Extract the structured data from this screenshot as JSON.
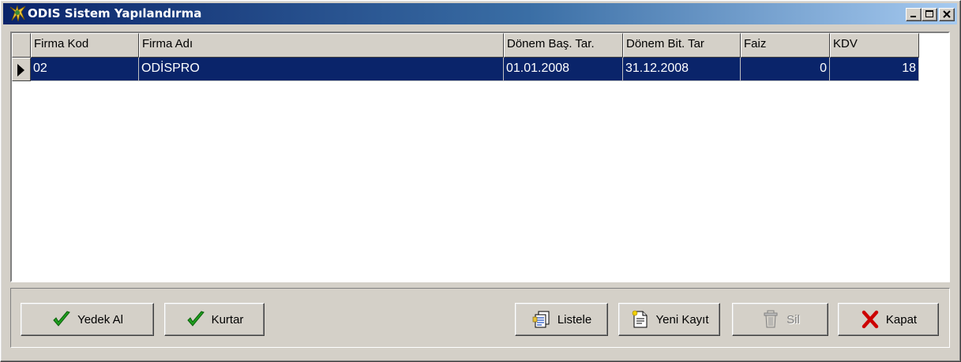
{
  "window": {
    "title": "ODIS Sistem Yapılandırma",
    "icon": "odis-app-icon",
    "controls": [
      "minimize-icon",
      "maximize-icon",
      "close-icon"
    ]
  },
  "grid": {
    "columns": [
      "Firma Kod",
      "Firma Adı",
      "Dönem Baş. Tar.",
      "Dönem Bit. Tar",
      "Faiz",
      "KDV"
    ],
    "rows": [
      {
        "firma_kod": "02",
        "firma_adi": "ODİSPRO",
        "donem_bas": "01.01.2008",
        "donem_bit": "31.12.2008",
        "faiz": "0",
        "kdv": "18"
      }
    ],
    "selection_color": "#0a246a"
  },
  "buttons": {
    "yedek_al": {
      "label": "Yedek Al",
      "icon": "check-icon"
    },
    "kurtar": {
      "label": "Kurtar",
      "icon": "check-icon"
    },
    "listele": {
      "label": "Listele",
      "icon": "list-document-icon"
    },
    "yeni_kayit": {
      "label": "Yeni Kayıt",
      "icon": "new-document-icon"
    },
    "sil": {
      "label": "Sil",
      "icon": "trash-icon",
      "enabled": false
    },
    "kapat": {
      "label": "Kapat",
      "icon": "red-x-icon"
    }
  },
  "colors": {
    "accent_check": "#1f9f1f",
    "close_red": "#cc0000",
    "face": "#d4d0c8"
  }
}
